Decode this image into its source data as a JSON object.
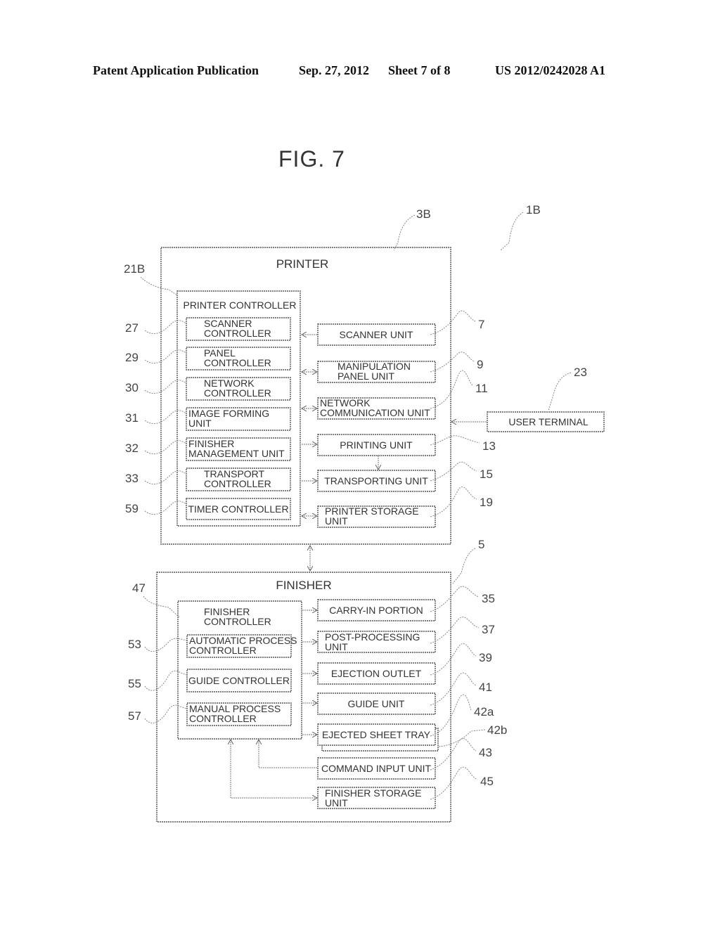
{
  "header": {
    "publication": "Patent Application Publication",
    "date": "Sep. 27, 2012",
    "sheet": "Sheet 7 of 8",
    "number": "US 2012/0242028 A1"
  },
  "figure": {
    "title": "FIG. 7"
  },
  "refs": {
    "system": "1B",
    "printer": "3B",
    "finisher": "5",
    "printer_controller": "21B",
    "user_terminal": "23",
    "scanner_unit": "7",
    "manipulation_panel_unit": "9",
    "network_communication_unit": "11",
    "printing_unit": "13",
    "transporting_unit": "15",
    "printer_storage_unit": "19",
    "scanner_controller": "27",
    "panel_controller": "29",
    "network_controller": "30",
    "image_forming_unit": "31",
    "finisher_management_unit": "32",
    "transport_controller": "33",
    "timer_controller": "59",
    "finisher_controller": "47",
    "automatic_process_controller": "53",
    "guide_controller": "55",
    "manual_process_controller": "57",
    "carry_in_portion": "35",
    "post_processing_unit": "37",
    "ejection_outlet": "39",
    "guide_unit": "41",
    "ejected_sheet_tray_a": "42a",
    "ejected_sheet_tray_b": "42b",
    "command_input_unit": "43",
    "finisher_storage_unit": "45"
  },
  "printer": {
    "title": "PRINTER",
    "controller_title": "PRINTER CONTROLLER",
    "controllers": [
      [
        "SCANNER",
        "CONTROLLER"
      ],
      [
        "PANEL",
        "CONTROLLER"
      ],
      [
        "NETWORK",
        "CONTROLLER"
      ],
      [
        "IMAGE FORMING",
        "UNIT"
      ],
      [
        "FINISHER",
        "MANAGEMENT UNIT"
      ],
      [
        "TRANSPORT",
        "CONTROLLER"
      ],
      [
        "TIMER CONTROLLER"
      ]
    ],
    "units": [
      [
        "SCANNER UNIT"
      ],
      [
        "MANIPULATION",
        "PANEL UNIT"
      ],
      [
        "NETWORK",
        "COMMUNICATION UNIT"
      ],
      [
        "PRINTING UNIT"
      ],
      [
        "TRANSPORTING UNIT"
      ],
      [
        "PRINTER STORAGE",
        "UNIT"
      ]
    ]
  },
  "user_terminal": "USER TERMINAL",
  "finisher": {
    "title": "FINISHER",
    "controller_title": [
      "FINISHER",
      "CONTROLLER"
    ],
    "controllers": [
      [
        "AUTOMATIC PROCESS",
        "CONTROLLER"
      ],
      [
        "GUIDE CONTROLLER"
      ],
      [
        "MANUAL PROCESS",
        "CONTROLLER"
      ]
    ],
    "units": [
      [
        "CARRY-IN PORTION"
      ],
      [
        "POST-PROCESSING",
        "UNIT"
      ],
      [
        "EJECTION OUTLET"
      ],
      [
        "GUIDE UNIT"
      ],
      [
        "EJECTED SHEET TRAY"
      ],
      [
        "COMMAND INPUT UNIT"
      ],
      [
        "FINISHER STORAGE",
        "UNIT"
      ]
    ]
  }
}
